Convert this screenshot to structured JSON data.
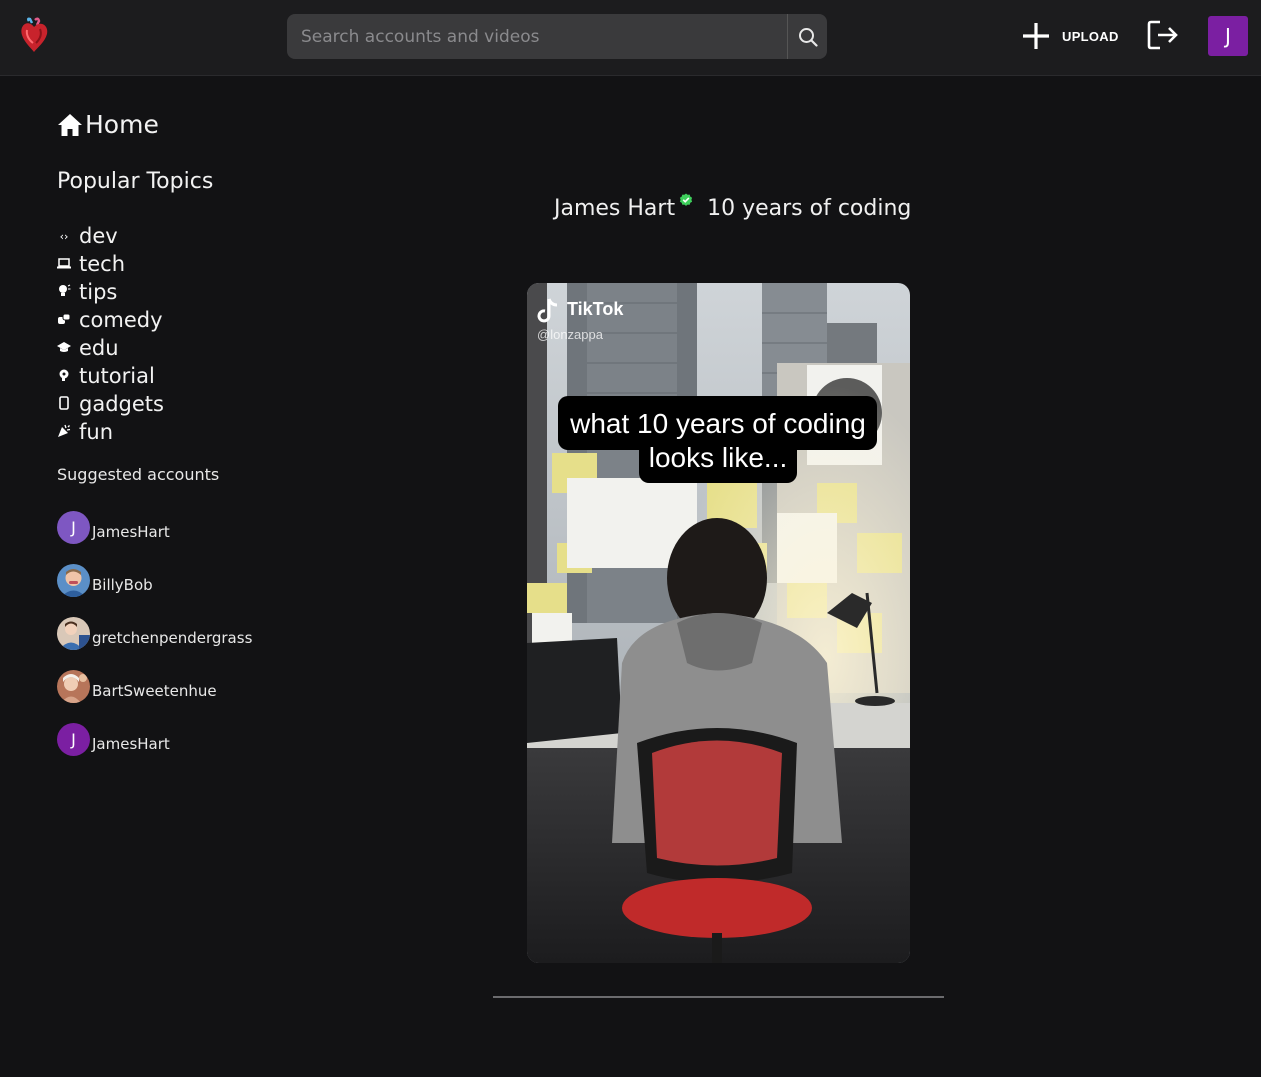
{
  "header": {
    "search_placeholder": "Search accounts and videos",
    "upload_label": "UPLOAD",
    "user_initial": "J"
  },
  "sidebar": {
    "home_label": "Home",
    "topics_title": "Popular Topics",
    "topics": [
      {
        "icon": "code-icon",
        "label": "dev"
      },
      {
        "icon": "laptop-icon",
        "label": "tech"
      },
      {
        "icon": "lightbulb-icon",
        "label": "tips"
      },
      {
        "icon": "theater-masks-icon",
        "label": "comedy"
      },
      {
        "icon": "graduation-cap-icon",
        "label": "edu"
      },
      {
        "icon": "brain-icon",
        "label": "tutorial"
      },
      {
        "icon": "mobile-icon",
        "label": "gadgets"
      },
      {
        "icon": "party-popper-icon",
        "label": "fun"
      }
    ],
    "suggested_title": "Suggested accounts",
    "accounts": [
      {
        "name": "JamesHart",
        "initial": "J",
        "color": "#7e57c2"
      },
      {
        "name": "BillyBob",
        "initial": "",
        "color": "#5b8fc7"
      },
      {
        "name": "gretchenpendergrass",
        "initial": "",
        "color": "#8a6f5a"
      },
      {
        "name": "BartSweetenhue",
        "initial": "",
        "color": "#b7755a"
      },
      {
        "name": "JamesHart",
        "initial": "J",
        "color": "#7b1fa2"
      }
    ]
  },
  "post": {
    "author": "James Hart",
    "caption": "10 years of coding",
    "video_overlay_line1": "what 10 years of coding",
    "video_overlay_line2": "looks like...",
    "watermark": "TikTok",
    "watermark_handle": "@lonzappa"
  },
  "colors": {
    "background": "#121214",
    "topbar": "#1c1c1e",
    "accent_purple": "#7b1fa2",
    "verified_green": "#3ecf5c"
  }
}
